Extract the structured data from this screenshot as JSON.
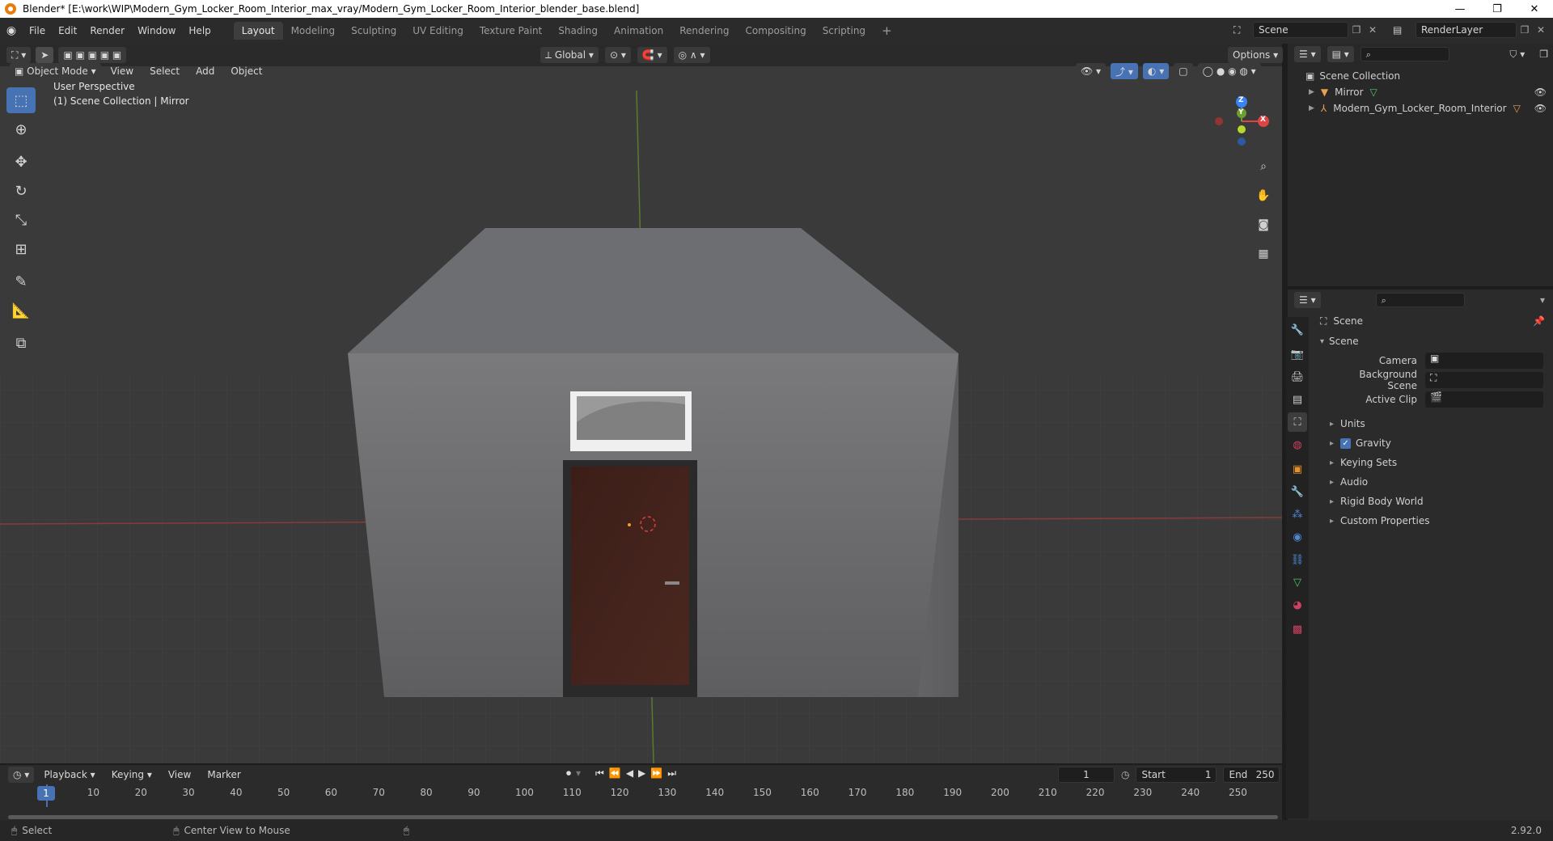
{
  "window": {
    "title": "Blender* [E:\\work\\WIP\\Modern_Gym_Locker_Room_Interior_max_vray/Modern_Gym_Locker_Room_Interior_blender_base.blend]",
    "minimize": "—",
    "maximize": "❐",
    "close": "✕"
  },
  "topbar": {
    "menus": [
      "File",
      "Edit",
      "Render",
      "Window",
      "Help"
    ],
    "workspaces": [
      "Layout",
      "Modeling",
      "Sculpting",
      "UV Editing",
      "Texture Paint",
      "Shading",
      "Animation",
      "Rendering",
      "Compositing",
      "Scripting"
    ],
    "active_workspace": "Layout",
    "add_workspace": "+",
    "scene_name": "Scene",
    "view_layer": "RenderLayer"
  },
  "viewport_header": {
    "mode": "Object Mode",
    "menus": [
      "View",
      "Select",
      "Add",
      "Object"
    ],
    "transform_orientation": "Global",
    "options": "Options"
  },
  "viewport": {
    "perspective_label": "User Perspective",
    "collection_label": "(1) Scene Collection | Mirror",
    "gizmo_axes": [
      "Z",
      "Y",
      "X"
    ]
  },
  "outliner": {
    "root": "Scene Collection",
    "items": [
      {
        "name": "Mirror"
      },
      {
        "name": "Modern_Gym_Locker_Room_Interior"
      }
    ]
  },
  "properties": {
    "context": "Scene",
    "panel_title": "Scene",
    "fields": [
      {
        "label": "Camera",
        "value": ""
      },
      {
        "label": "Background Scene",
        "value": ""
      },
      {
        "label": "Active Clip",
        "value": ""
      }
    ],
    "sections": [
      "Units",
      "Gravity",
      "Keying Sets",
      "Audio",
      "Rigid Body World",
      "Custom Properties"
    ],
    "gravity_checked": true
  },
  "timeline": {
    "menus": [
      "Playback",
      "Keying",
      "View",
      "Marker"
    ],
    "current_frame": "1",
    "start_label": "Start",
    "start": "1",
    "end_label": "End",
    "end": "250",
    "ruler": [
      "1",
      "10",
      "20",
      "30",
      "40",
      "50",
      "60",
      "70",
      "80",
      "90",
      "100",
      "110",
      "120",
      "130",
      "140",
      "150",
      "160",
      "170",
      "180",
      "190",
      "200",
      "210",
      "220",
      "230",
      "240",
      "250"
    ]
  },
  "statusbar": {
    "select": "Select",
    "center_view": "Center View to Mouse",
    "version": "2.92.0"
  }
}
